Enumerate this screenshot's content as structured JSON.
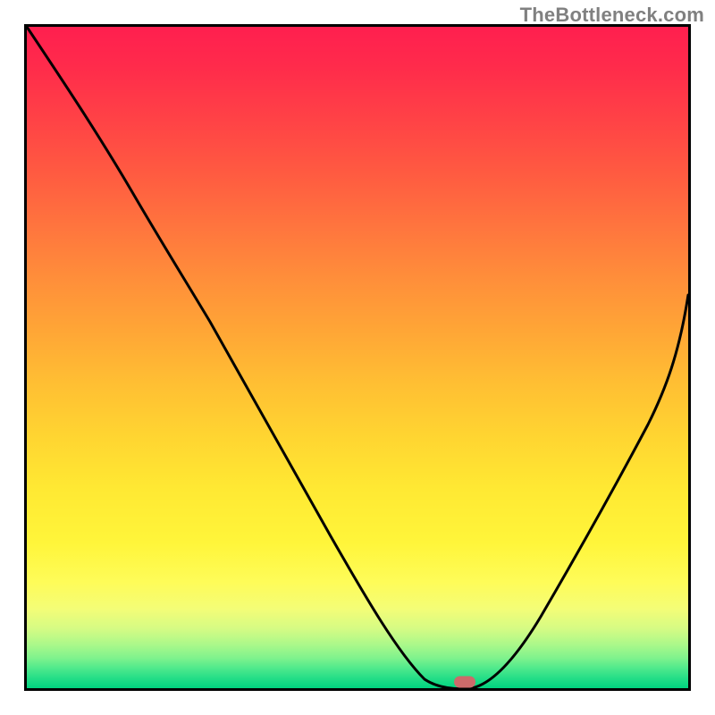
{
  "watermark": "TheBottleneck.com",
  "colors": {
    "frame_border": "#000000",
    "curve_stroke": "#000000",
    "marker_fill": "#cc6a6a",
    "gradient_top": "#ff1f4f",
    "gradient_bottom": "#00d27f"
  },
  "chart_data": {
    "type": "line",
    "title": "",
    "xlabel": "",
    "ylabel": "",
    "xlim": [
      0,
      100
    ],
    "ylim": [
      0,
      100
    ],
    "grid": false,
    "legend": false,
    "background": "vertical-gradient red→yellow→green",
    "series": [
      {
        "name": "bottleneck-curve",
        "x": [
          0,
          7,
          14,
          20,
          26,
          33,
          40,
          47,
          54,
          58,
          62,
          65,
          68,
          72,
          76,
          80,
          85,
          90,
          95,
          100
        ],
        "y": [
          100,
          90,
          80,
          72,
          64,
          54,
          43,
          31,
          18,
          10,
          4,
          1,
          0,
          1,
          5,
          12,
          22,
          34,
          47,
          60
        ]
      }
    ],
    "annotations": [
      {
        "name": "optimum-marker",
        "x": 66,
        "y": 0,
        "shape": "rounded-rect",
        "color": "#cc6a6a"
      }
    ]
  }
}
